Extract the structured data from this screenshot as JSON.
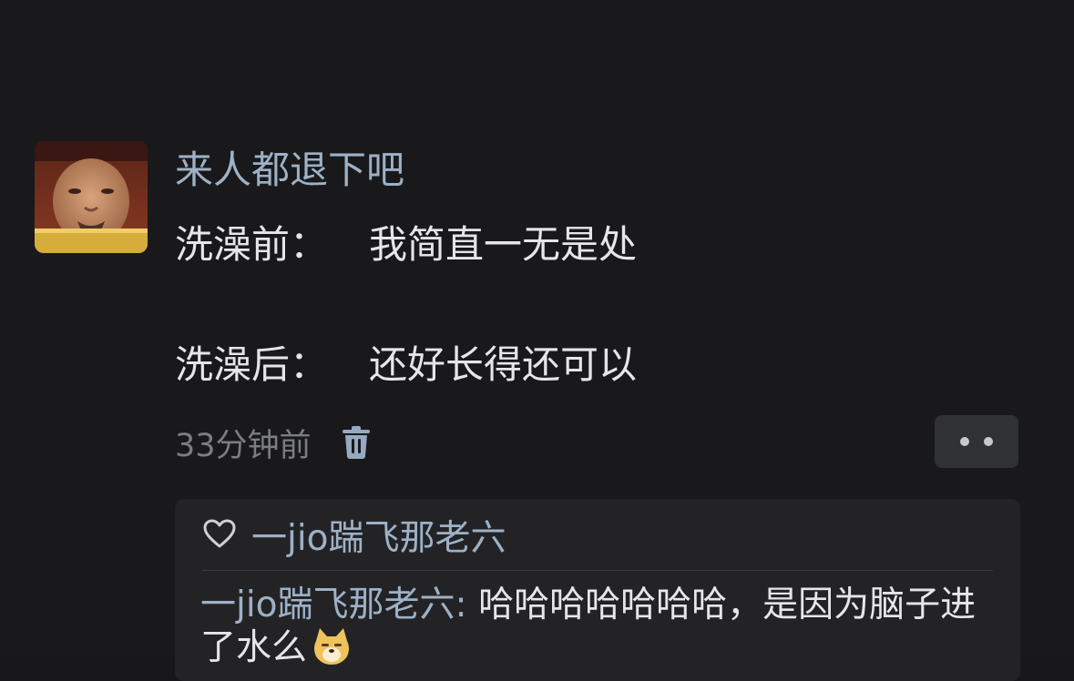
{
  "post": {
    "username": "来人都退下吧",
    "lines": [
      {
        "label": "洗澡前：",
        "text": "我简直一无是处"
      },
      {
        "label": "洗澡后：",
        "text": "还好长得还可以"
      }
    ],
    "time": "33分钟前"
  },
  "replies": {
    "liked_by": "一jio踹飞那老六",
    "items": [
      {
        "author": "一jio踹飞那老六",
        "separator": ": ",
        "text": "哈哈哈哈哈哈哈，是因为脑子进了水么"
      }
    ]
  },
  "icons": {
    "avatar": "avatar-photo",
    "delete": "trash-icon",
    "more": "more-dots-icon",
    "like": "heart-outline-icon",
    "emoji": "doge-emoji-icon"
  },
  "colors": {
    "background": "#19191b",
    "username": "#9db1c6",
    "text": "#e6e6e8",
    "muted": "#7b7d80",
    "reply_box": "#232326",
    "icon_blue": "#95aac2"
  }
}
